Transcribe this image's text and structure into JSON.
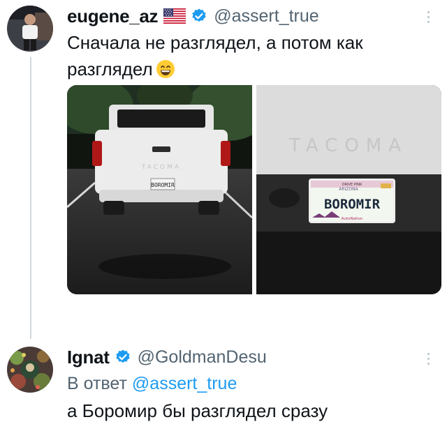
{
  "tweet1": {
    "display_name": "eugene_az",
    "flag_icon": "us-flag-icon",
    "handle": "@assert_true",
    "text": "Сначала не разглядел, а потом как разглядел",
    "emoji": "grinning-face-emoji",
    "media": {
      "left_plate_text": "BOROMIR",
      "right_tailgate_text": "TACOMA",
      "plate_top": "DRIVE PINK",
      "plate_state": "ARIZONA",
      "plate_number": "BOROMIR",
      "plate_bottom": "AutoNation"
    }
  },
  "tweet2": {
    "display_name": "Ignat",
    "handle": "@GoldmanDesu",
    "reply_prefix": "В ответ",
    "reply_handle": "@assert_true",
    "text": "а Боромир бы разглядел сразу"
  },
  "colors": {
    "verified_blue": "#1d9bf0",
    "secondary_text": "#536471",
    "thread_line": "#cfd9de"
  }
}
